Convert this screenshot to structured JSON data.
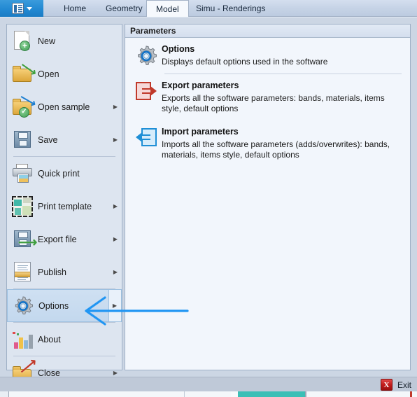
{
  "ribbon": {
    "app_button": {
      "icon": "book-icon",
      "caret": "chevron-down-icon"
    },
    "tabs": [
      {
        "label": "Home",
        "active": false
      },
      {
        "label": "Geometry",
        "active": false
      },
      {
        "label": "Model",
        "active": true
      },
      {
        "label": "Simu - Renderings",
        "active": false
      }
    ]
  },
  "left_menu": {
    "items": [
      {
        "label": "New",
        "icon": "new-document-icon",
        "submenu": false,
        "selected": false
      },
      {
        "label": "Open",
        "icon": "open-folder-icon",
        "submenu": false,
        "selected": false
      },
      {
        "label": "Open sample",
        "icon": "open-sample-icon",
        "submenu": true,
        "selected": false
      },
      {
        "label": "Save",
        "icon": "save-floppy-icon",
        "submenu": true,
        "selected": false
      },
      {
        "label": "Quick print",
        "icon": "printer-icon",
        "submenu": false,
        "selected": false
      },
      {
        "label": "Print template",
        "icon": "print-template-icon",
        "submenu": true,
        "selected": false
      },
      {
        "label": "Export file",
        "icon": "export-file-icon",
        "submenu": true,
        "selected": false
      },
      {
        "label": "Publish",
        "icon": "publish-icon",
        "submenu": true,
        "selected": false
      },
      {
        "label": "Options",
        "icon": "gear-icon",
        "submenu": true,
        "selected": true
      },
      {
        "label": "About",
        "icon": "about-chart-icon",
        "submenu": false,
        "selected": false
      },
      {
        "label": "Close",
        "icon": "close-folder-icon",
        "submenu": true,
        "selected": false
      }
    ],
    "separator_after": [
      3,
      8,
      9
    ]
  },
  "right_panel": {
    "header": "Parameters",
    "entries": [
      {
        "title": "Options",
        "description": "Displays default options used in the software",
        "icon": "gear-icon"
      },
      {
        "title": "Export parameters",
        "description": "Exports all the software parameters: bands, materials, items style, default options",
        "icon": "export-arrow-icon"
      },
      {
        "title": "Import parameters",
        "description": "Imports all the software parameters (adds/overwrites): bands, materials, items style, default options",
        "icon": "import-arrow-icon"
      }
    ]
  },
  "footer": {
    "exit_label": "Exit",
    "exit_glyph": "X"
  },
  "colors": {
    "accent_blue": "#1b7cc4",
    "annotation_arrow": "#2196f3",
    "exit_red": "#c21c1c",
    "panel_background": "#f2f6fc",
    "menu_background": "#dde5f0",
    "selection_blue": "#c3d8ee"
  }
}
